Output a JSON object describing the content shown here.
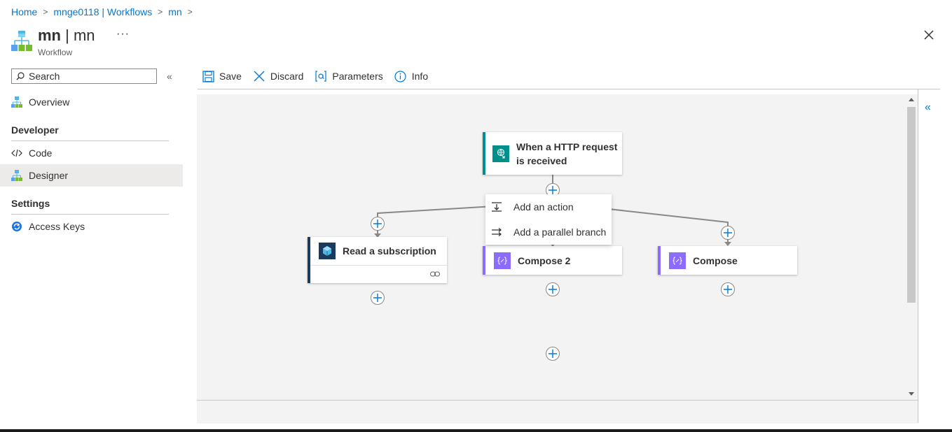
{
  "breadcrumb": {
    "home": "Home",
    "workflows": "mnge0118 | Workflows",
    "current": "mn",
    "sep": ">"
  },
  "header": {
    "title_bold": "mn",
    "title_rest": "| mn",
    "subtitle": "Workflow",
    "more": "···"
  },
  "sidebar": {
    "search_placeholder": "Search",
    "collapse": "«",
    "overview": "Overview",
    "developer_section": "Developer",
    "code": "Code",
    "designer": "Designer",
    "settings_section": "Settings",
    "access_keys": "Access Keys"
  },
  "toolbar": {
    "save": "Save",
    "discard": "Discard",
    "parameters": "Parameters",
    "info": "Info"
  },
  "designer": {
    "trigger": {
      "line1": "When a HTTP request",
      "line2": "is received"
    },
    "read_subscription": "Read a subscription",
    "compose2": "Compose 2",
    "compose": "Compose",
    "menu": {
      "add_action": "Add an action",
      "add_parallel": "Add a parallel branch"
    },
    "collapse_right": "«"
  },
  "colors": {
    "accent": "#0078d4",
    "trigger": "#008f8a",
    "compose": "#8c6cff",
    "resource": "#1b3a5c"
  }
}
